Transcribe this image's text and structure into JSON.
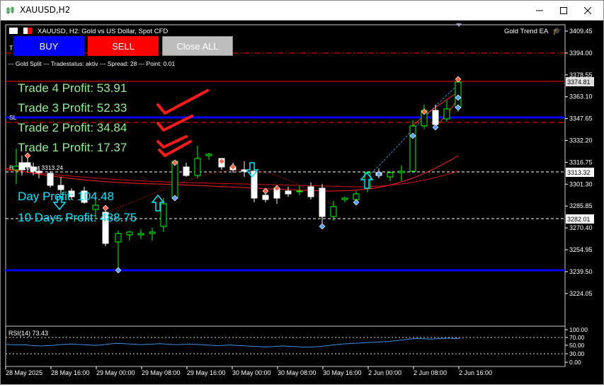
{
  "window": {
    "title": "XAUUSD,H2"
  },
  "chart": {
    "header": "XAUUSD, H2:  Gold vs US Dollar, Spot CFD",
    "ea_name": "Gold Trend EA",
    "status_line": "--- Gold Split --- Tradestatus: aktiv --- Spread: 28 --- Point: 0.01",
    "sl_label": "SL",
    "entry_label": "Buy 0.01 at 3313.24",
    "t_label": "T"
  },
  "buttons": {
    "buy": "BUY",
    "sell": "SELL",
    "close_all": "Close ALL"
  },
  "profits": {
    "trade4": "Trade 4 Profit: 53.91",
    "trade3": "Trade 3 Profit: 52.33",
    "trade2": "Trade 2 Profit: 34.84",
    "trade1": "Trade 1 Profit: 17.37",
    "day": "Day Profit: 104.48",
    "ten_days": "10 Days Profit: 488.75"
  },
  "price_axis": [
    "3409.45",
    "3394.00",
    "3378.55",
    "3363.10",
    "3347.65",
    "3332.20",
    "3316.75",
    "3301.30",
    "3285.85",
    "3270.40",
    "3254.95",
    "3239.50",
    "3224.05"
  ],
  "price_markers": {
    "current": "3374.81",
    "entry": "3313.32",
    "lower": "3282.01"
  },
  "time_axis": [
    "28 May 2025",
    "28 May 16:00",
    "29 May 00:00",
    "29 May 08:00",
    "29 May 16:00",
    "30 May 00:00",
    "30 May 08:00",
    "30 May 16:00",
    "2 Jun 00:00",
    "2 Jun 08:00",
    "2 Jun 16:00"
  ],
  "rsi": {
    "label": "RSI(14) 73.43",
    "levels": [
      "100.00",
      "70.00",
      "50.00",
      "30.00",
      "0.00"
    ],
    "values": [
      55,
      54,
      53,
      54,
      52,
      51,
      50,
      51,
      52,
      54,
      55,
      56,
      55,
      54,
      53,
      52,
      53,
      55,
      57,
      58,
      57,
      56,
      55,
      54,
      55,
      56,
      57,
      56,
      55,
      54,
      55,
      56,
      55,
      54,
      53,
      52,
      51,
      52,
      53,
      52,
      51,
      50,
      49,
      48,
      47,
      48,
      49,
      50,
      49,
      48,
      47,
      46,
      47,
      48,
      50,
      52,
      54,
      56,
      57,
      58,
      59,
      60,
      61,
      62,
      63,
      64,
      66,
      68,
      70,
      72,
      73,
      72,
      71,
      72,
      73,
      74,
      73,
      73
    ]
  },
  "colors": {
    "bull": "#00ff00",
    "bear": "#ffffff",
    "sl_line": "#0000ff",
    "ma": "#ff0000",
    "text_green": "#90ee90",
    "text_cyan": "#00e5ff"
  }
}
